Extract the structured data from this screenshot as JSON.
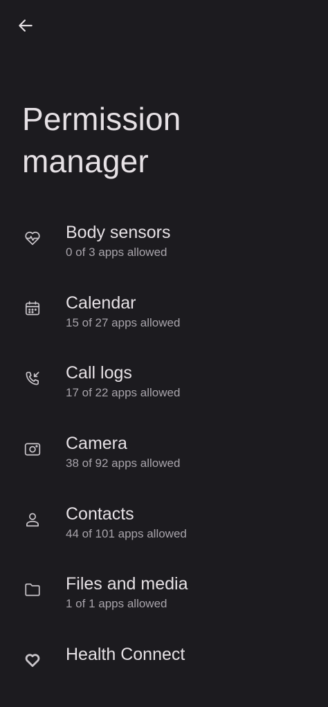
{
  "header": {
    "back_icon": "arrow-back-icon",
    "title": "Permission manager"
  },
  "colors": {
    "background": "#1c1b1f",
    "primary_text": "#e6e1e5",
    "secondary_text": "#a8a4ab",
    "icon": "#c9c5ca"
  },
  "permissions": [
    {
      "label": "Body sensors",
      "summary": "0 of 3 apps allowed",
      "icon": "heart-pulse-icon"
    },
    {
      "label": "Calendar",
      "summary": "15 of 27 apps allowed",
      "icon": "calendar-icon"
    },
    {
      "label": "Call logs",
      "summary": "17 of 22 apps allowed",
      "icon": "call-log-icon"
    },
    {
      "label": "Camera",
      "summary": "38 of 92 apps allowed",
      "icon": "camera-icon"
    },
    {
      "label": "Contacts",
      "summary": "44 of 101 apps allowed",
      "icon": "person-icon"
    },
    {
      "label": "Files and media",
      "summary": "1 of 1 apps allowed",
      "icon": "folder-icon"
    },
    {
      "label": "Health Connect",
      "summary": "",
      "icon": "health-connect-icon"
    }
  ]
}
